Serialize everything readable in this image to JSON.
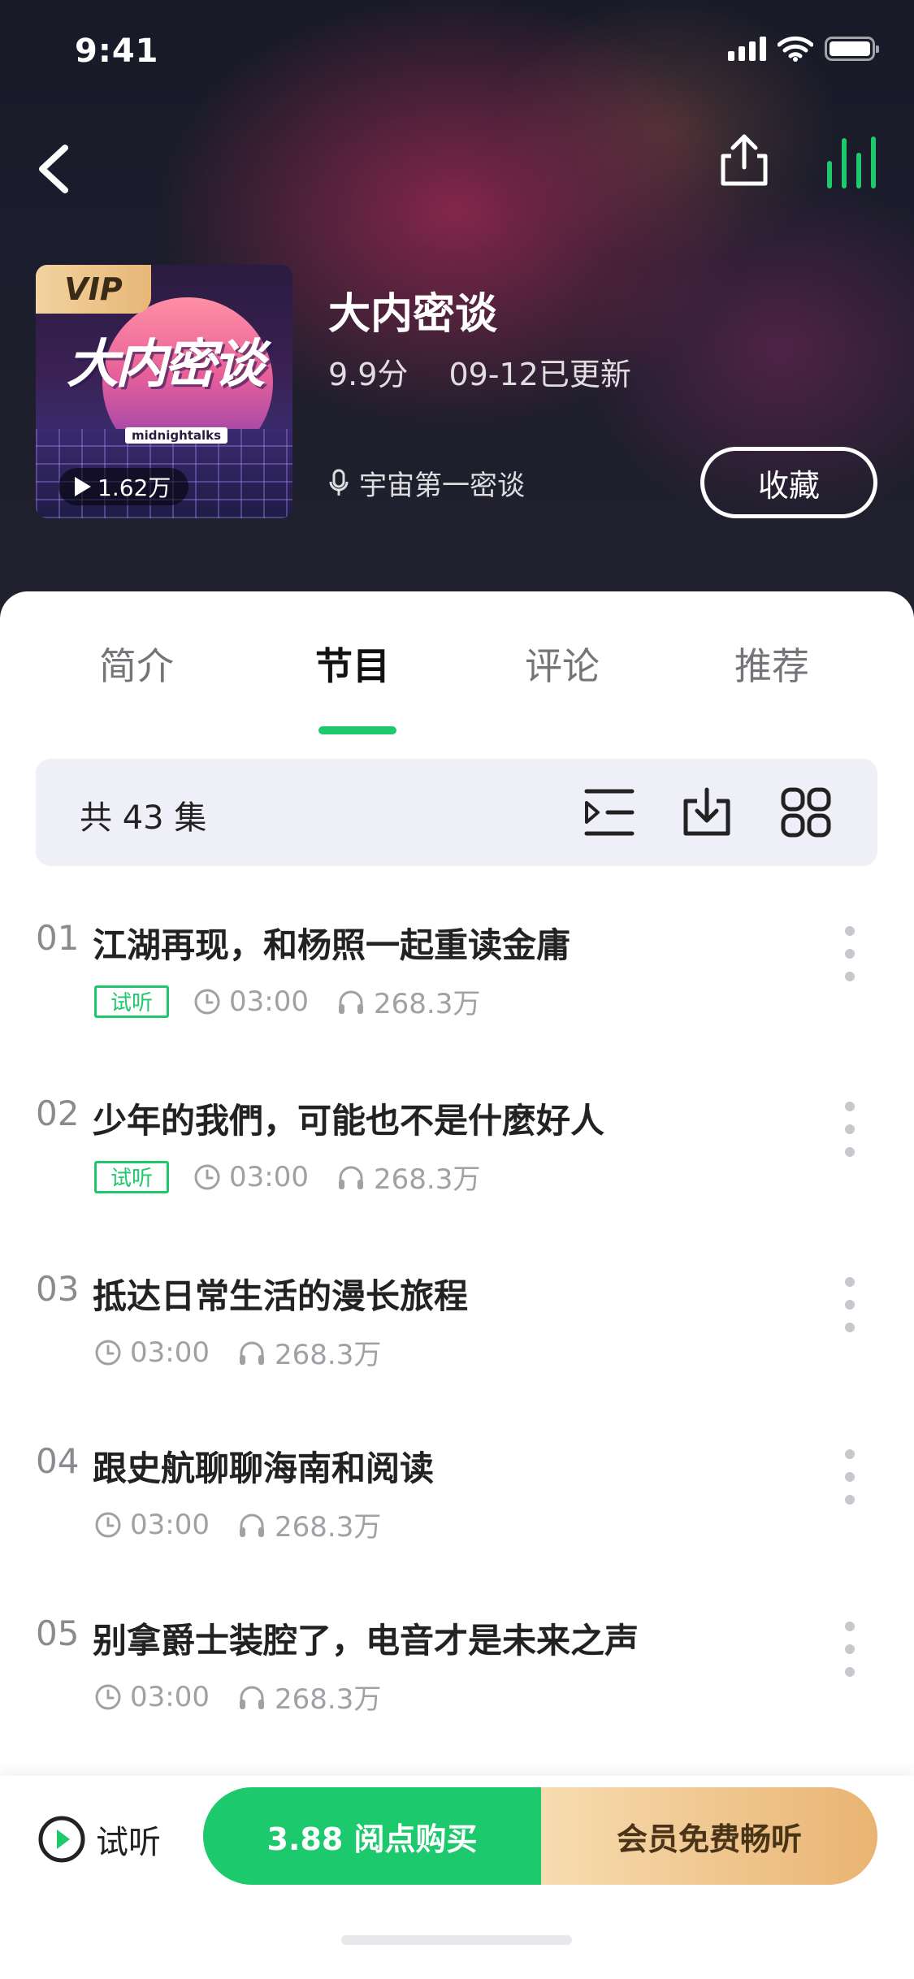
{
  "status_bar": {
    "time": "9:41"
  },
  "icons": {
    "back": "chevron-left-icon",
    "share": "share-icon",
    "playing": "sound-wave-icon",
    "mic": "microphone-icon",
    "sort": "sort-list-icon",
    "download": "download-icon",
    "grid": "grid-icon",
    "clock": "clock-icon",
    "headphones": "headphones-icon",
    "more": "more-vertical-icon",
    "trial_play": "play-circle-icon"
  },
  "album": {
    "cover_title": "大内密谈",
    "cover_subtitle": "midnightalks",
    "vip_badge": "VIP",
    "plays": "1.62万",
    "title": "大内密谈",
    "score": "9.9分",
    "updated": "09-12已更新",
    "host": "宇宙第一密谈",
    "collect_label": "收藏"
  },
  "tabs": [
    {
      "label": "简介",
      "active": false
    },
    {
      "label": "节目",
      "active": true
    },
    {
      "label": "评论",
      "active": false
    },
    {
      "label": "推荐",
      "active": false
    }
  ],
  "toolbar": {
    "count": "共 43 集"
  },
  "episodes": [
    {
      "num": "01",
      "title": "江湖再现，和杨照一起重读金庸",
      "trial": "试听",
      "duration": "03:00",
      "listens": "268.3万"
    },
    {
      "num": "02",
      "title": "少年的我們，可能也不是什麼好人",
      "trial": "试听",
      "duration": "03:00",
      "listens": "268.3万"
    },
    {
      "num": "03",
      "title": "抵达日常生活的漫长旅程",
      "trial": "",
      "duration": "03:00",
      "listens": "268.3万"
    },
    {
      "num": "04",
      "title": "跟史航聊聊海南和阅读",
      "trial": "",
      "duration": "03:00",
      "listens": "268.3万"
    },
    {
      "num": "05",
      "title": "别拿爵士装腔了，电音才是未来之声",
      "trial": "",
      "duration": "03:00",
      "listens": "268.3万"
    }
  ],
  "bottom": {
    "trial_label": "试听",
    "buy_label": "3.88 阅点购买",
    "vip_label": "会员免费畅听"
  },
  "colors": {
    "accent_green": "#1ec86b",
    "vip_gold_start": "#f7dcb0",
    "vip_gold_end": "#e9b472"
  }
}
